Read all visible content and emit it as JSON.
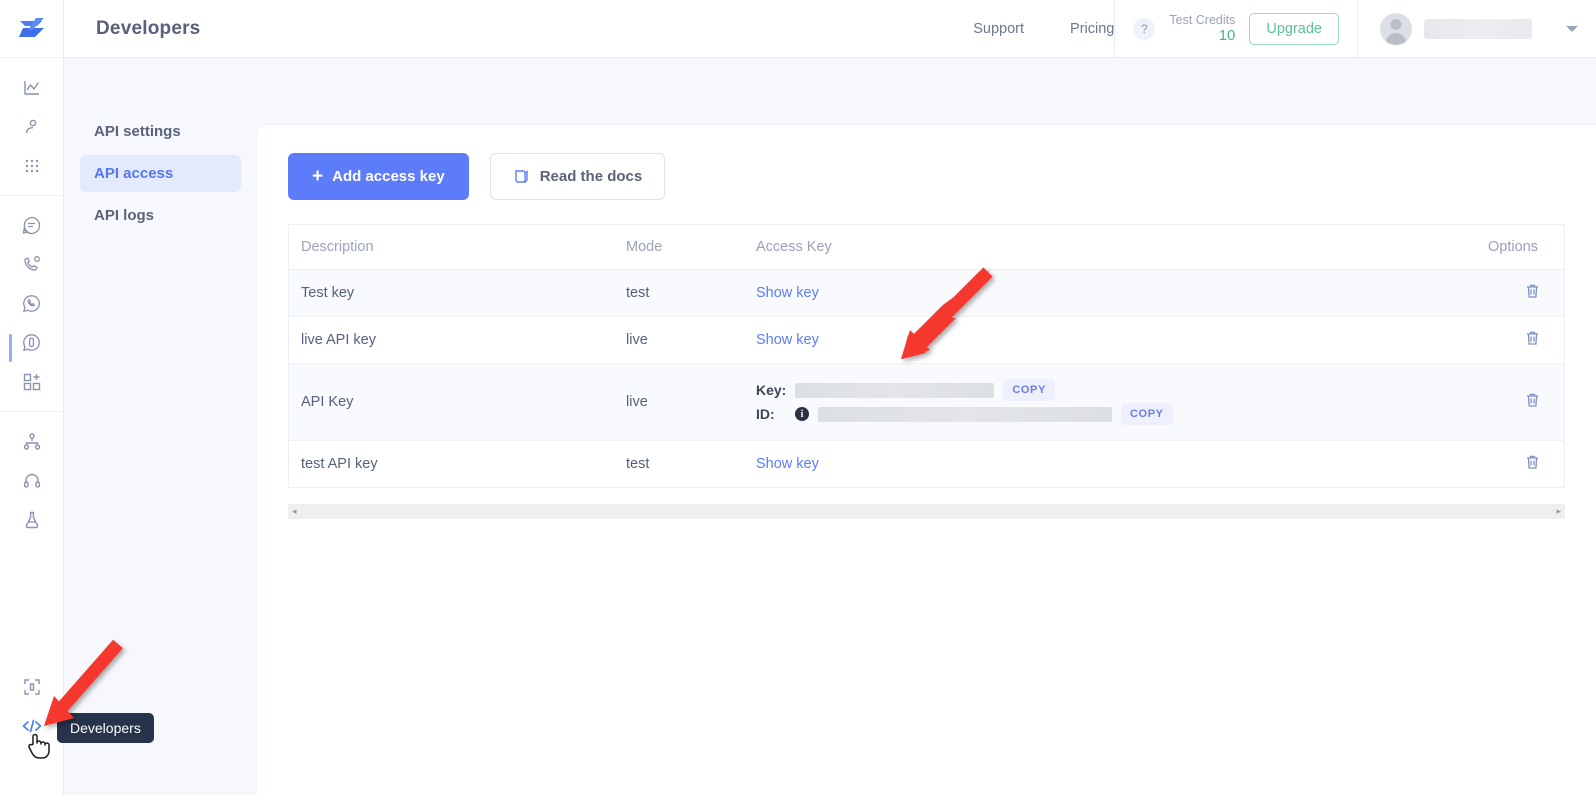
{
  "header": {
    "title": "Developers",
    "links": [
      {
        "label": "Support",
        "name": "support-link"
      },
      {
        "label": "Pricing",
        "name": "pricing-link"
      }
    ],
    "help_badge": "?",
    "credits_label": "Test Credits",
    "credits_value": "10",
    "upgrade_label": "Upgrade",
    "account_name_redacted": "",
    "accent_primary": "#5c7cfa",
    "accent_green": "#59c49b"
  },
  "rail": {
    "logo": "brand-logo-icon",
    "groups": [
      {
        "items": [
          {
            "icon": "analytics-chart-icon",
            "active": false
          },
          {
            "icon": "contact-person-icon",
            "active": false
          },
          {
            "icon": "keypad-dots-icon",
            "active": false
          }
        ]
      },
      {
        "items": [
          {
            "icon": "chat-bubble-icon",
            "active": false
          },
          {
            "icon": "phone-call-icon",
            "active": false
          },
          {
            "icon": "whatsapp-icon",
            "active": false
          },
          {
            "icon": "rcs-message-icon",
            "active": false
          },
          {
            "icon": "add-app-grid-icon",
            "active": false
          }
        ]
      },
      {
        "items": [
          {
            "icon": "flow-hierarchy-icon",
            "active": false
          },
          {
            "icon": "headset-support-icon",
            "active": false
          },
          {
            "icon": "lab-flask-icon",
            "active": false
          }
        ]
      },
      {
        "items": [
          {
            "icon": "integrations-puzzle-icon",
            "active": false
          },
          {
            "icon": "developers-code-icon",
            "active": true
          }
        ]
      }
    ]
  },
  "subnav": {
    "items": [
      {
        "label": "API settings",
        "name": "sidebar-item-api-settings",
        "active": false
      },
      {
        "label": "API access",
        "name": "sidebar-item-api-access",
        "active": true
      },
      {
        "label": "API logs",
        "name": "sidebar-item-api-logs",
        "active": false
      }
    ]
  },
  "toolbar": {
    "add_key_label": "Add access key",
    "add_key_icon": "plus-icon",
    "read_docs_label": "Read the docs",
    "read_docs_icon": "book-icon"
  },
  "table": {
    "columns": [
      "Description",
      "Mode",
      "Access Key",
      "Options"
    ],
    "rows": [
      {
        "description": "Test key",
        "mode": "test",
        "access_key_type": "link",
        "access_key_label": "Show key",
        "delete_icon": "trash-icon"
      },
      {
        "description": "live API key",
        "mode": "live",
        "access_key_type": "link",
        "access_key_label": "Show key",
        "delete_icon": "trash-icon"
      },
      {
        "description": "API Key",
        "mode": "live",
        "access_key_type": "revealed",
        "key_label": "Key:",
        "key_value_redacted": "",
        "key_copy_label": "COPY",
        "id_label": "ID:",
        "id_info_icon": "info-icon",
        "id_value_redacted": "",
        "id_copy_label": "COPY",
        "delete_icon": "trash-icon"
      },
      {
        "description": "test API key",
        "mode": "test",
        "access_key_type": "link",
        "access_key_label": "Show key",
        "delete_icon": "trash-icon"
      }
    ],
    "scrollbar": {
      "left_arrow": "◂",
      "right_arrow": "▸"
    }
  },
  "tooltip": {
    "text": "Developers"
  },
  "annotations": {
    "arrow_color": "#f5392f",
    "arrows": [
      {
        "name": "arrow-to-key-field"
      },
      {
        "name": "arrow-to-developers-nav"
      }
    ]
  }
}
